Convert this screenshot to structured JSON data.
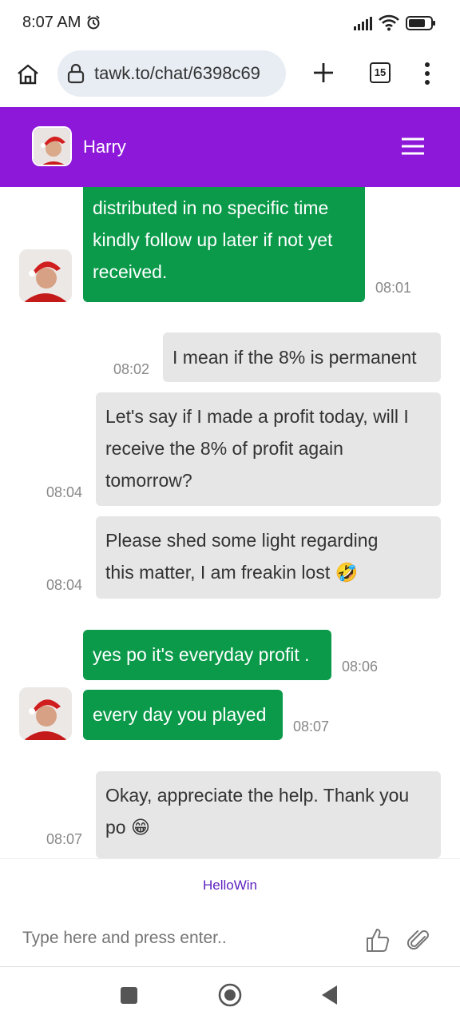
{
  "status_bar": {
    "time": "8:07 AM"
  },
  "browser": {
    "url": "tawk.to/chat/6398c69",
    "tab_count": "15"
  },
  "chat": {
    "agent_name": "Harry"
  },
  "messages": [
    {
      "sender": "agent",
      "lines": [
        "distributed in no specific time",
        "kindly follow up later if not yet",
        "received."
      ],
      "time": "08:01"
    },
    {
      "sender": "user",
      "lines": [
        "I mean if the 8% is permanent"
      ],
      "time": "08:02"
    },
    {
      "sender": "user",
      "lines": [
        "Let's say if I made a profit today, will I",
        "receive the 8% of profit again",
        "tomorrow?"
      ],
      "time": "08:04"
    },
    {
      "sender": "user",
      "lines": [
        "Please shed some light regarding",
        "this matter, I am freakin lost 🤣"
      ],
      "time": "08:04"
    },
    {
      "sender": "agent",
      "lines": [
        "yes po it's everyday profit ."
      ],
      "time": "08:06"
    },
    {
      "sender": "agent",
      "lines": [
        "every day you played"
      ],
      "time": "08:07"
    },
    {
      "sender": "user",
      "lines": [
        "Okay, appreciate the help. Thank you",
        "po 😁"
      ],
      "time": "08:07"
    }
  ],
  "footer": {
    "brand": "HelloWin",
    "input_placeholder": "Type here and press enter.."
  },
  "colors": {
    "header": "#8e18d9",
    "agent_bubble": "#0a9a4a",
    "user_bubble": "#e6e6e6"
  },
  "icons": [
    "alarm-icon",
    "signal-icon",
    "wifi-icon",
    "battery-icon",
    "home-icon",
    "lock-icon",
    "plus-icon",
    "menu-dots-icon",
    "hamburger-icon",
    "thumbs-up-icon",
    "paperclip-icon"
  ]
}
